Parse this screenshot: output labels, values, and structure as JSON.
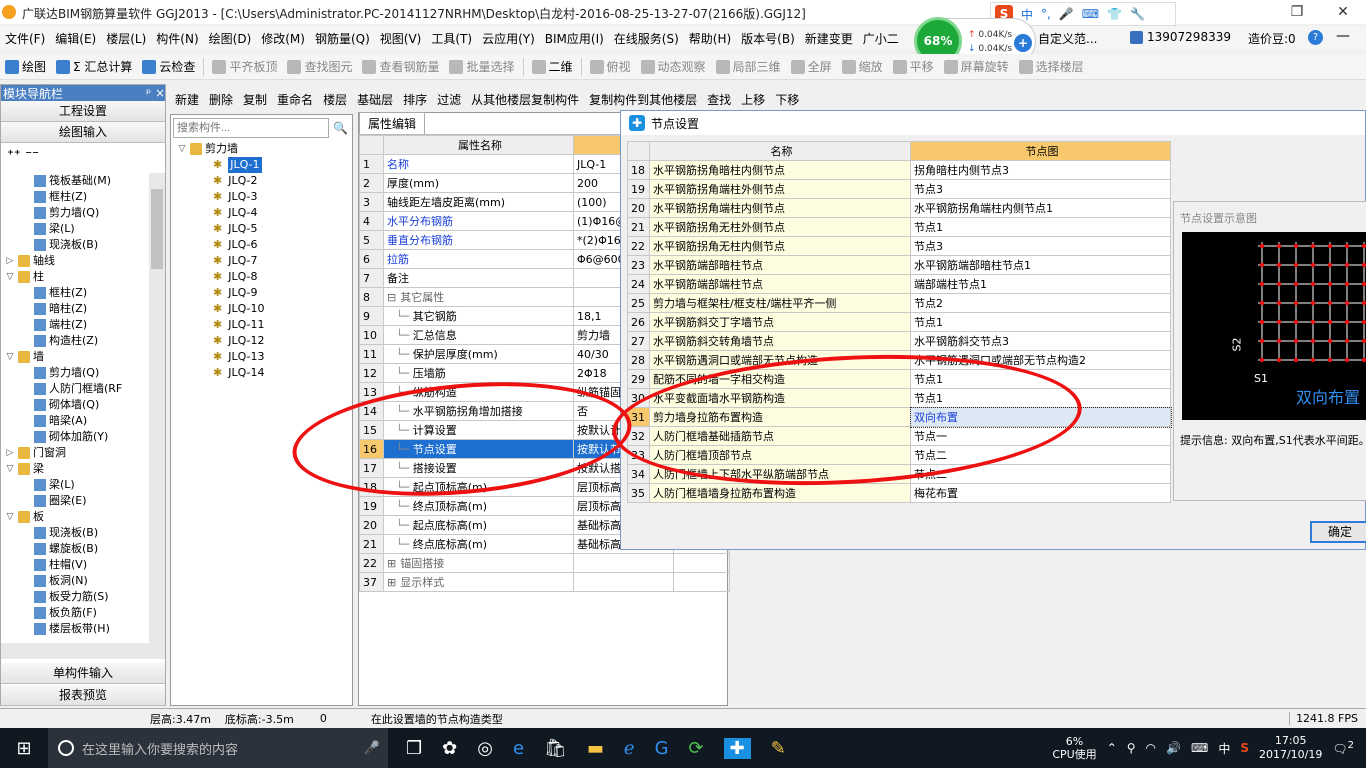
{
  "app": {
    "title": "广联达BIM钢筋算量软件 GGJ2013 - [C:\\Users\\Administrator.PC-20141127NRHM\\Desktop\\白龙村-2016-08-25-13-27-07(2166版).GGJ12]"
  },
  "menu": [
    "文件(F)",
    "编辑(E)",
    "楼层(L)",
    "构件(N)",
    "绘图(D)",
    "修改(M)",
    "钢筋量(Q)",
    "视图(V)",
    "工具(T)",
    "云应用(Y)",
    "BIM应用(I)",
    "在线服务(S)",
    "帮助(H)",
    "版本号(B)",
    "新建变更",
    "广小二"
  ],
  "overlay": {
    "percent": "68%",
    "up": "0.04K/s",
    "down": "0.04K/s",
    "custom": "自定义范...",
    "phone": "13907298339",
    "price": "造价豆:0"
  },
  "toolbar": [
    "绘图",
    "Σ 汇总计算",
    "云检查",
    "平齐板顶",
    "查找图元",
    "查看钢筋量",
    "批量选择",
    "二维",
    "俯视",
    "动态观察",
    "局部三维",
    "全屏",
    "缩放",
    "平移",
    "屏幕旋转",
    "选择楼层"
  ],
  "toolbar2": [
    "新建",
    "删除",
    "复制",
    "重命名",
    "楼层",
    "基础层",
    "排序",
    "过滤",
    "从其他楼层复制构件",
    "复制构件到其他楼层",
    "查找",
    "上移",
    "下移"
  ],
  "nav": {
    "title": "模块导航栏",
    "pin": "ᵖ",
    "close": "×",
    "btn1": "工程设置",
    "btn2": "绘图输入",
    "btn3": "单构件输入",
    "btn4": "报表预览",
    "items": [
      {
        "t": "筏板基础(M)",
        "lvl": 2
      },
      {
        "t": "框柱(Z)",
        "lvl": 2
      },
      {
        "t": "剪力墙(Q)",
        "lvl": 2
      },
      {
        "t": "梁(L)",
        "lvl": 2
      },
      {
        "t": "现浇板(B)",
        "lvl": 2
      },
      {
        "t": "轴线",
        "lvl": 1,
        "f": true,
        "c": "▷"
      },
      {
        "t": "柱",
        "lvl": 1,
        "f": true,
        "c": "▽"
      },
      {
        "t": "框柱(Z)",
        "lvl": 2
      },
      {
        "t": "暗柱(Z)",
        "lvl": 2
      },
      {
        "t": "端柱(Z)",
        "lvl": 2
      },
      {
        "t": "构造柱(Z)",
        "lvl": 2
      },
      {
        "t": "墙",
        "lvl": 1,
        "f": true,
        "c": "▽"
      },
      {
        "t": "剪力墙(Q)",
        "lvl": 2
      },
      {
        "t": "人防门框墙(RF",
        "lvl": 2
      },
      {
        "t": "砌体墙(Q)",
        "lvl": 2
      },
      {
        "t": "暗梁(A)",
        "lvl": 2
      },
      {
        "t": "砌体加筋(Y)",
        "lvl": 2
      },
      {
        "t": "门窗洞",
        "lvl": 1,
        "f": true,
        "c": "▷"
      },
      {
        "t": "梁",
        "lvl": 1,
        "f": true,
        "c": "▽"
      },
      {
        "t": "梁(L)",
        "lvl": 2
      },
      {
        "t": "圈梁(E)",
        "lvl": 2
      },
      {
        "t": "板",
        "lvl": 1,
        "f": true,
        "c": "▽"
      },
      {
        "t": "现浇板(B)",
        "lvl": 2
      },
      {
        "t": "螺旋板(B)",
        "lvl": 2
      },
      {
        "t": "柱帽(V)",
        "lvl": 2
      },
      {
        "t": "板洞(N)",
        "lvl": 2
      },
      {
        "t": "板受力筋(S)",
        "lvl": 2
      },
      {
        "t": "板负筋(F)",
        "lvl": 2
      },
      {
        "t": "楼层板带(H)",
        "lvl": 2
      }
    ]
  },
  "comp": {
    "search": "搜索构件...",
    "root": "剪力墙",
    "items": [
      "JLQ-1",
      "JLQ-2",
      "JLQ-3",
      "JLQ-4",
      "JLQ-5",
      "JLQ-6",
      "JLQ-7",
      "JLQ-8",
      "JLQ-9",
      "JLQ-10",
      "JLQ-11",
      "JLQ-12",
      "JLQ-13",
      "JLQ-14"
    ]
  },
  "prop": {
    "tab": "属性编辑",
    "hname": "属性名称",
    "rows": [
      {
        "n": "1",
        "k": "名称",
        "v": "JLQ-1",
        "blue": true
      },
      {
        "n": "2",
        "k": "厚度(mm)",
        "v": "200"
      },
      {
        "n": "3",
        "k": "轴线距左墙皮距离(mm)",
        "v": "(100)"
      },
      {
        "n": "4",
        "k": "水平分布钢筋",
        "v": "(1)Φ16@",
        "blue": true
      },
      {
        "n": "5",
        "k": "垂直分布钢筋",
        "v": "*(2)Φ16@",
        "blue": true
      },
      {
        "n": "6",
        "k": "拉筋",
        "v": "Φ6@600*",
        "blue": true
      },
      {
        "n": "7",
        "k": "备注",
        "v": ""
      },
      {
        "n": "8",
        "k": "其它属性",
        "v": "",
        "g": "⊟"
      },
      {
        "n": "9",
        "k": "其它钢筋",
        "v": "18,1",
        "i": 1
      },
      {
        "n": "10",
        "k": "汇总信息",
        "v": "剪力墙",
        "i": 1
      },
      {
        "n": "11",
        "k": "保护层厚度(mm)",
        "v": "40/30",
        "i": 1
      },
      {
        "n": "12",
        "k": "压墙筋",
        "v": "2Φ18",
        "i": 1
      },
      {
        "n": "13",
        "k": "纵筋构造",
        "v": "纵筋锚固",
        "i": 1
      },
      {
        "n": "14",
        "k": "水平钢筋拐角增加搭接",
        "v": "否",
        "i": 1
      },
      {
        "n": "15",
        "k": "计算设置",
        "v": "按默认计",
        "i": 1
      },
      {
        "n": "16",
        "k": "节点设置",
        "v": "按默认节",
        "i": 1,
        "sel": true
      },
      {
        "n": "17",
        "k": "搭接设置",
        "v": "按默认搭",
        "i": 1
      },
      {
        "n": "18",
        "k": "起点顶标高(m)",
        "v": "层顶标高",
        "i": 1
      },
      {
        "n": "19",
        "k": "终点顶标高(m)",
        "v": "层顶标高",
        "i": 1
      },
      {
        "n": "20",
        "k": "起点底标高(m)",
        "v": "基础标高",
        "i": 1
      },
      {
        "n": "21",
        "k": "终点底标高(m)",
        "v": "基础标高",
        "i": 1
      },
      {
        "n": "22",
        "k": "锚固搭接",
        "v": "",
        "g": "⊞"
      },
      {
        "n": "37",
        "k": "显示样式",
        "v": "",
        "g": "⊞"
      }
    ]
  },
  "dialog": {
    "title": "节点设置",
    "close": "×",
    "hname": "名称",
    "hnode": "节点图",
    "rows": [
      {
        "n": "18",
        "k": "水平钢筋拐角暗柱内侧节点",
        "v": "拐角暗柱内侧节点3"
      },
      {
        "n": "19",
        "k": "水平钢筋拐角端柱外侧节点",
        "v": "节点3"
      },
      {
        "n": "20",
        "k": "水平钢筋拐角端柱内侧节点",
        "v": "水平钢筋拐角端柱内侧节点1"
      },
      {
        "n": "21",
        "k": "水平钢筋拐角无柱外侧节点",
        "v": "节点1"
      },
      {
        "n": "22",
        "k": "水平钢筋拐角无柱内侧节点",
        "v": "节点3"
      },
      {
        "n": "23",
        "k": "水平钢筋端部暗柱节点",
        "v": "水平钢筋端部暗柱节点1"
      },
      {
        "n": "24",
        "k": "水平钢筋端部端柱节点",
        "v": "端部端柱节点1"
      },
      {
        "n": "25",
        "k": "剪力墙与框架柱/框支柱/端柱平齐一侧",
        "v": "节点2"
      },
      {
        "n": "26",
        "k": "水平钢筋斜交丁字墙节点",
        "v": "节点1"
      },
      {
        "n": "27",
        "k": "水平钢筋斜交转角墙节点",
        "v": "水平钢筋斜交节点3"
      },
      {
        "n": "28",
        "k": "水平钢筋遇洞口或端部无节点构造",
        "v": "水平钢筋遇洞口或端部无节点构造2"
      },
      {
        "n": "29",
        "k": "配筋不同的墙一字相交构造",
        "v": "节点1"
      },
      {
        "n": "30",
        "k": "水平变截面墙水平钢筋构造",
        "v": "节点1"
      },
      {
        "n": "31",
        "k": "剪力墙身拉筋布置构造",
        "v": "双向布置",
        "sel": true
      },
      {
        "n": "32",
        "k": "人防门框墙基础插筋节点",
        "v": "节点一"
      },
      {
        "n": "33",
        "k": "人防门框墙顶部节点",
        "v": "节点二"
      },
      {
        "n": "34",
        "k": "人防门框墙上下部水平纵筋端部节点",
        "v": "节点二"
      },
      {
        "n": "35",
        "k": "人防门框墙墙身拉筋布置构造",
        "v": "梅花布置"
      }
    ],
    "preview_title": "节点设置示意图",
    "s1": "S1",
    "s2": "S2",
    "preview_label": "双向布置",
    "hint_label": "提示信息:",
    "hint": "双向布置,S1代表水平间距。",
    "ok": "确定"
  },
  "status": {
    "floor": "层高:3.47m",
    "bottom": "底标高:-3.5m",
    "zero": "0",
    "msg": "在此设置墙的节点构造类型",
    "fps": "1241.8 FPS"
  },
  "taskbar": {
    "search": "在这里输入你要搜索的内容",
    "cpu": "6%",
    "cpu_label": "CPU使用",
    "time": "17:05",
    "date": "2017/10/19",
    "lang": "中",
    "notif": "2"
  }
}
